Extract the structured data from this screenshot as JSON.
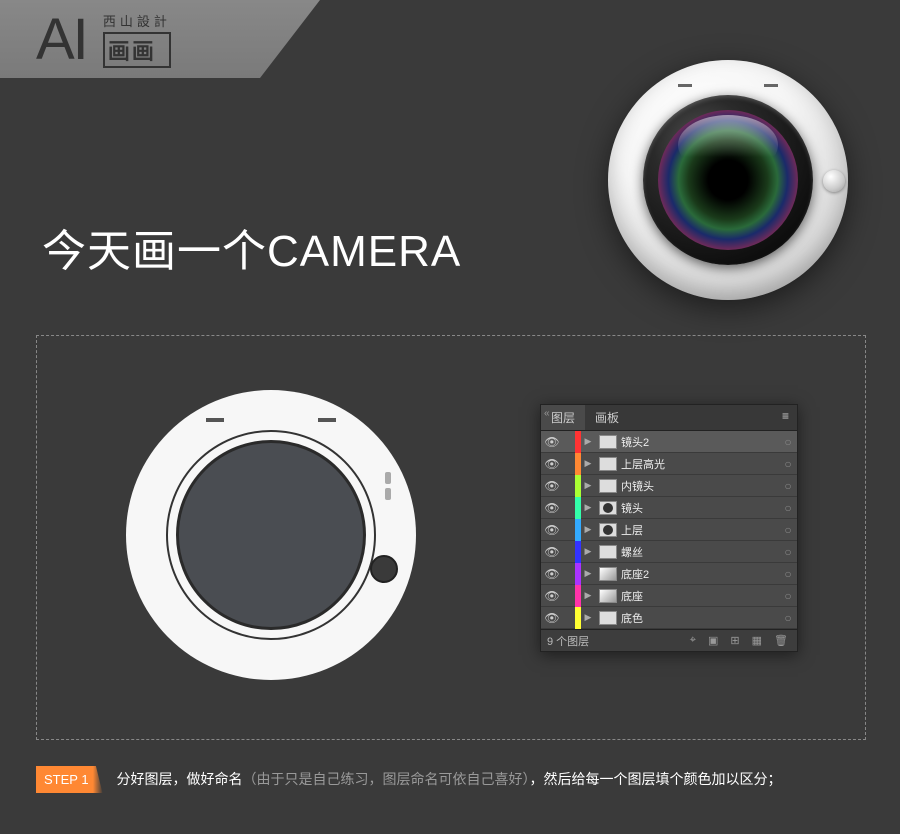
{
  "header": {
    "logo": "AI",
    "brand_top": "西山設計",
    "brand_bottom": "画画"
  },
  "title": "今天画一个CAMERA",
  "layers_panel": {
    "tabs": [
      "图层",
      "画板"
    ],
    "active_tab": 0,
    "menu_icon": "≡",
    "close_icon": "«",
    "layers": [
      {
        "color": "#ff3333",
        "name": "镜头2",
        "selected": true,
        "thumb": "blank"
      },
      {
        "color": "#ff8833",
        "name": "上层高光",
        "selected": false,
        "thumb": "blank"
      },
      {
        "color": "#aaff33",
        "name": "内镜头",
        "selected": false,
        "thumb": "blank"
      },
      {
        "color": "#33ffaa",
        "name": "镜头",
        "selected": false,
        "thumb": "circle"
      },
      {
        "color": "#33aaff",
        "name": "上层",
        "selected": false,
        "thumb": "circle"
      },
      {
        "color": "#3333ff",
        "name": "螺丝",
        "selected": false,
        "thumb": "blank"
      },
      {
        "color": "#aa33ff",
        "name": "底座2",
        "selected": false,
        "thumb": "grad"
      },
      {
        "color": "#ff33aa",
        "name": "底座",
        "selected": false,
        "thumb": "grad"
      },
      {
        "color": "#ffff33",
        "name": "底色",
        "selected": false,
        "thumb": "blank"
      }
    ],
    "footer_text": "9 个图层",
    "visibility_icon": "👁",
    "expand_icon": "▶",
    "target_icon": "○"
  },
  "step": {
    "badge": "STEP 1",
    "text_a": "分好图层，做好命名",
    "text_dim": "（由于只是自己练习，图层命名可依自己喜好）",
    "text_b": "，然后给每一个图层填个颜色加以区分；"
  }
}
